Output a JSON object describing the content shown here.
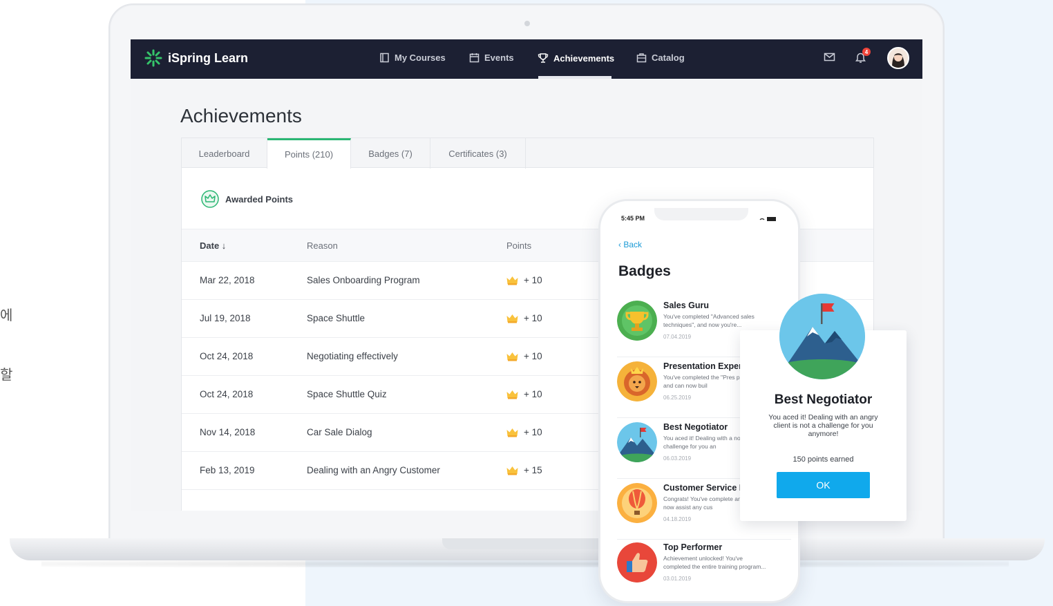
{
  "side_text": [
    "에",
    "할"
  ],
  "app": {
    "brand": "iSpring Learn",
    "nav": [
      {
        "label": "My Courses",
        "icon": "book-icon"
      },
      {
        "label": "Events",
        "icon": "calendar-icon"
      },
      {
        "label": "Achievements",
        "icon": "trophy-icon",
        "active": true
      },
      {
        "label": "Catalog",
        "icon": "briefcase-icon"
      }
    ],
    "notification_count": "4"
  },
  "page": {
    "title": "Achievements",
    "tabs": [
      "Leaderboard",
      "Points (210)",
      "Badges (7)",
      "Certificates (3)"
    ],
    "active_tab": "Points (210)",
    "section_title": "Awarded Points",
    "columns": {
      "date": "Date ↓",
      "reason": "Reason",
      "points": "Points"
    },
    "rows": [
      {
        "date": "Mar 22, 2018",
        "reason": "Sales Onboarding Program",
        "points": "+ 10"
      },
      {
        "date": "Jul 19, 2018",
        "reason": "Space Shuttle",
        "points": "+ 10"
      },
      {
        "date": "Oct 24, 2018",
        "reason": "Negotiating effectively",
        "points": "+ 10"
      },
      {
        "date": "Oct 24, 2018",
        "reason": "Space Shuttle Quiz",
        "points": "+ 10"
      },
      {
        "date": "Nov 14, 2018",
        "reason": "Car Sale Dialog",
        "points": "+ 10"
      },
      {
        "date": "Feb 13, 2019",
        "reason": "Dealing with an Angry Customer",
        "points": "+ 15"
      }
    ]
  },
  "phone": {
    "time": "5:45 PM",
    "back": "‹ Back",
    "title": "Badges",
    "badges": [
      {
        "name": "Sales Guru",
        "desc": "You've completed \"Advanced sales techniques\", and now you're...",
        "date": "07.04.2019",
        "icon": "trophy-badge-icon"
      },
      {
        "name": "Presentation Expert",
        "desc": "You've completed the \"Pres program and can now buil",
        "date": "06.25.2019",
        "icon": "lion-badge-icon"
      },
      {
        "name": "Best Negotiator",
        "desc": "You aced it! Dealing with a not a challenge for you an",
        "date": "06.03.2019",
        "icon": "mountain-badge-icon"
      },
      {
        "name": "Customer Service E",
        "desc": "Congrats! You've complete and can now assist any cus",
        "date": "04.18.2019",
        "icon": "balloon-badge-icon"
      },
      {
        "name": "Top Performer",
        "desc": "Achievement unlocked! You've completed the entire training program...",
        "date": "03.01.2019",
        "icon": "thumbs-up-badge-icon"
      }
    ]
  },
  "popup": {
    "title": "Best Negotiator",
    "text": "You aced it! Dealing with an angry client is not a challenge for you anymore!",
    "points": "150 points earned",
    "ok": "OK"
  }
}
